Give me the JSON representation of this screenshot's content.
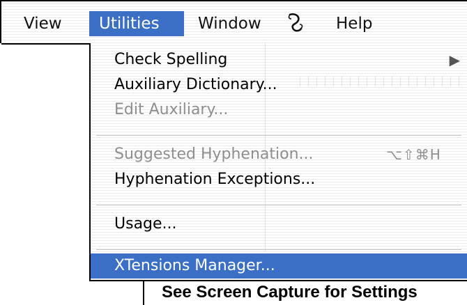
{
  "menubar": {
    "items": [
      {
        "label": "View"
      },
      {
        "label": "Utilities"
      },
      {
        "label": "Window"
      },
      {
        "label": "Help"
      }
    ],
    "script_icon": "script-menu-icon"
  },
  "dropdown": {
    "items": [
      {
        "label": "Check Spelling",
        "enabled": true,
        "submenu": "▶"
      },
      {
        "label": "Auxiliary Dictionary...",
        "enabled": true
      },
      {
        "label": "Edit Auxiliary...",
        "enabled": false
      },
      {
        "label": "Suggested Hyphenation...",
        "enabled": false,
        "shortcut": "⌥⇧⌘H"
      },
      {
        "label": "Hyphenation Exceptions...",
        "enabled": true
      },
      {
        "label": "Usage...",
        "enabled": true
      },
      {
        "label": "XTensions Manager...",
        "enabled": true,
        "highlighted": true
      }
    ]
  },
  "caption": "See Screen Capture for Settings",
  "colors": {
    "accent": "#3b6fc6",
    "disabled_text": "#8e8e8e"
  }
}
